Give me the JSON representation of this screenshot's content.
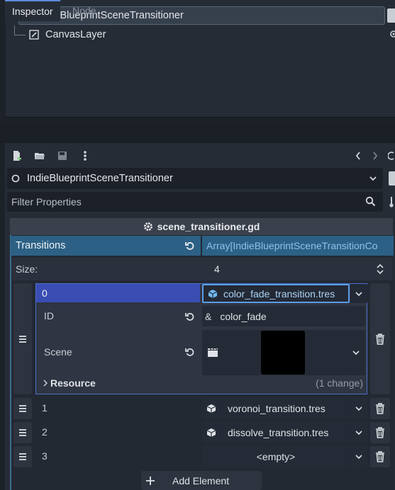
{
  "scene_tree": {
    "root_node": "IndieBlueprintSceneTransitioner",
    "child_node": "CanvasLayer"
  },
  "tabs": [
    "Inspector",
    "Node"
  ],
  "inspector": {
    "object_name": "IndieBlueprintSceneTransitioner",
    "filter_placeholder": "Filter Properties",
    "script_name": "scene_transitioner.gd",
    "property": {
      "label": "Transitions",
      "type_value": "Array[IndieBlueprintSceneTransitionCo",
      "size_label": "Size:",
      "size_value": "4",
      "elements": [
        {
          "index": "0",
          "resource": "color_fade_transition.tres",
          "sub": {
            "id_label": "ID",
            "id_prefix": "&",
            "id_value": "color_fade",
            "scene_label": "Scene",
            "resource_group": "Resource",
            "change_note": "(1 change)"
          }
        },
        {
          "index": "1",
          "resource": "voronoi_transition.tres"
        },
        {
          "index": "2",
          "resource": "dissolve_transition.tres"
        },
        {
          "index": "3",
          "resource": "<empty>"
        }
      ],
      "add_label": "Add Element"
    }
  },
  "colors": {
    "accent": "#2c6185",
    "link_text": "#8ec0ec",
    "selected_element": "#3a4db3",
    "focus_border": "#5c9ce6",
    "panel_bg": "#262c36"
  }
}
